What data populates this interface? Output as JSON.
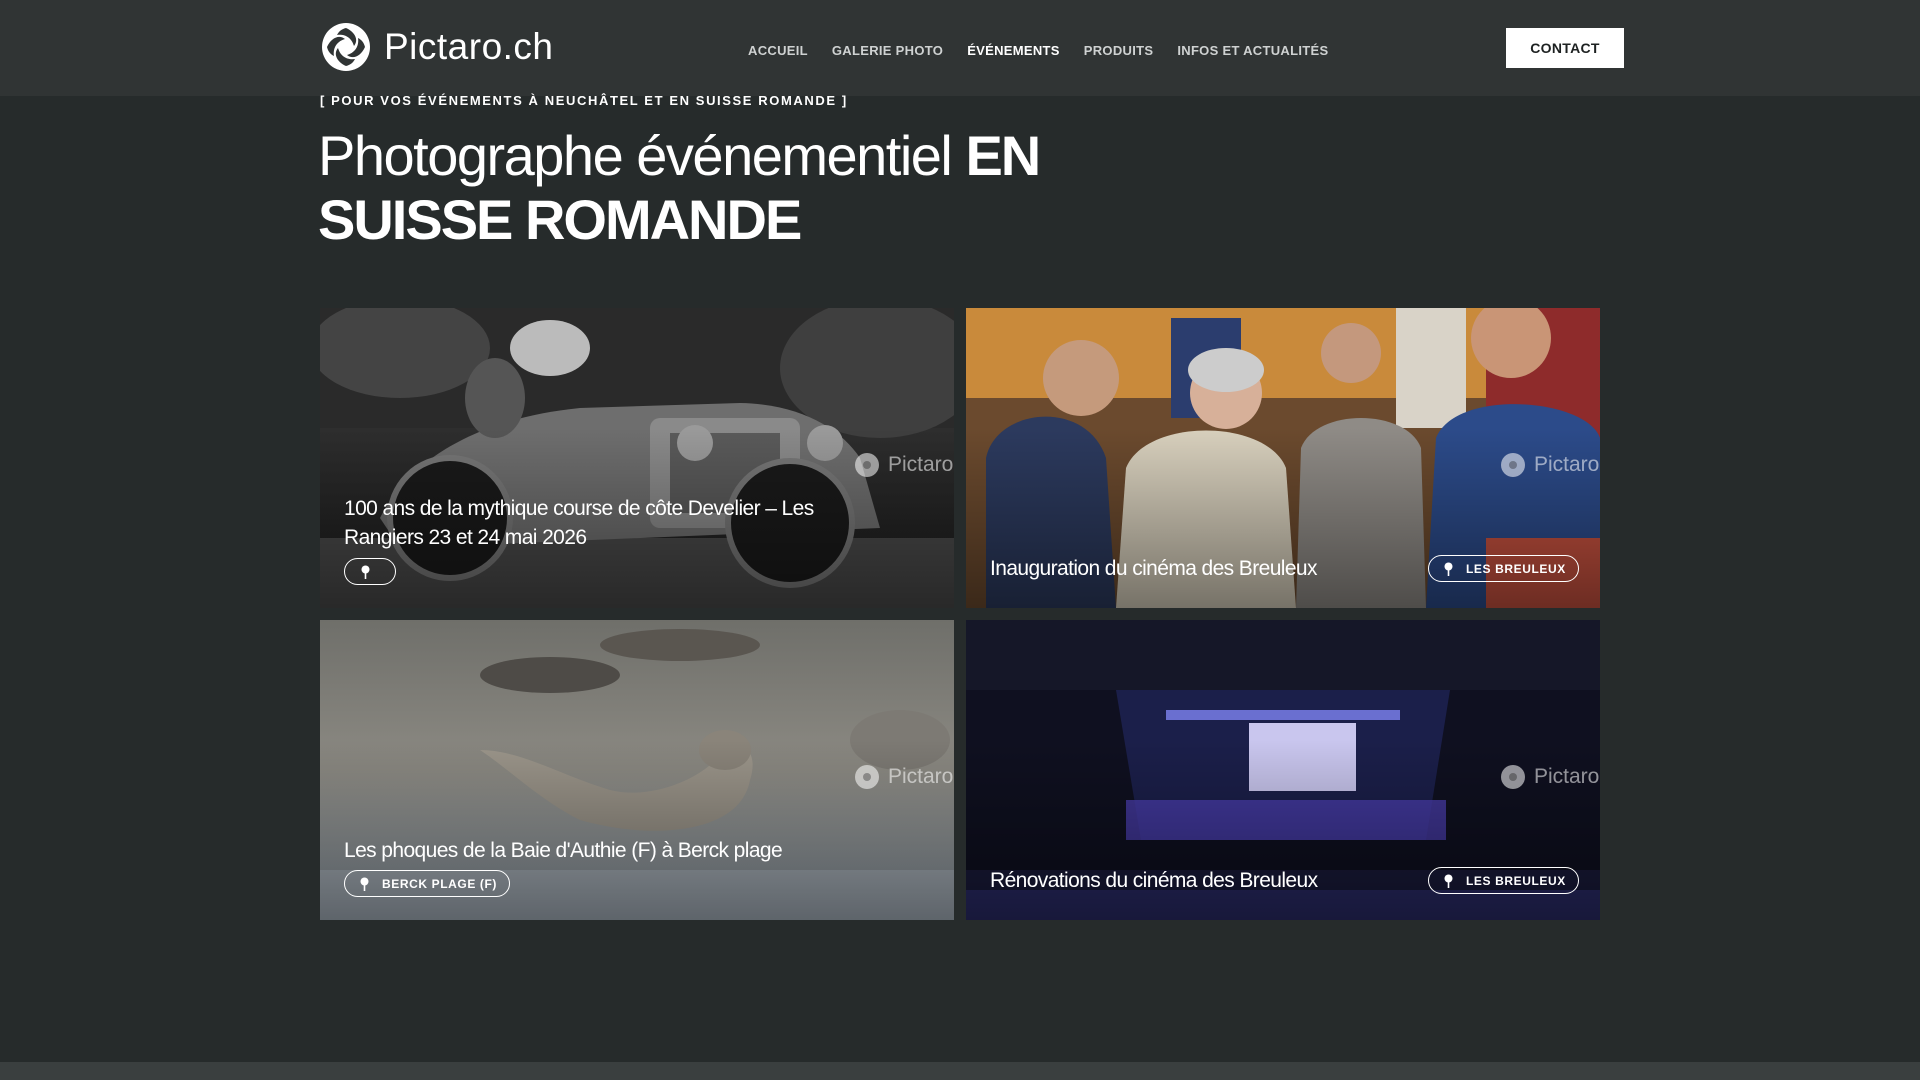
{
  "brand": {
    "name": "Pictaro.ch",
    "logo_icon": "aperture-logo-icon"
  },
  "nav": {
    "items": [
      {
        "label": "ACCUEIL",
        "active": false
      },
      {
        "label": "GALERIE PHOTO",
        "active": false
      },
      {
        "label": "ÉVÉNEMENTS",
        "active": true
      },
      {
        "label": "PRODUITS",
        "active": false
      },
      {
        "label": "INFOS ET ACTUALITÉS",
        "active": false
      }
    ],
    "contact_label": "CONTACT"
  },
  "hero": {
    "eyebrow": "[ POUR VOS ÉVÉNEMENTS À NEUCHÂTEL ET EN SUISSE ROMANDE ]",
    "title_regular": "Photographe événementiel ",
    "title_bold": "EN SUISSE ROMANDE"
  },
  "events": [
    {
      "title": "100 ans de la mythique course de côte Develier – Les Rangiers 23 et 24 mai 2026",
      "location": "",
      "watermark": "Pictaro"
    },
    {
      "title": "Inauguration du cinéma des Breuleux",
      "location": "LES BREULEUX",
      "watermark": "Pictaro"
    },
    {
      "title": "Les phoques de la Baie d'Authie (F) à Berck plage",
      "location": "BERCK PLAGE (F)",
      "watermark": "Pictaro"
    },
    {
      "title": "Rénovations du cinéma des Breuleux",
      "location": "LES BREULEUX",
      "watermark": "Pictaro"
    }
  ],
  "colors": {
    "page_bg": "#262b2b",
    "header_bg": "#303434",
    "accent": "#ffffff"
  }
}
